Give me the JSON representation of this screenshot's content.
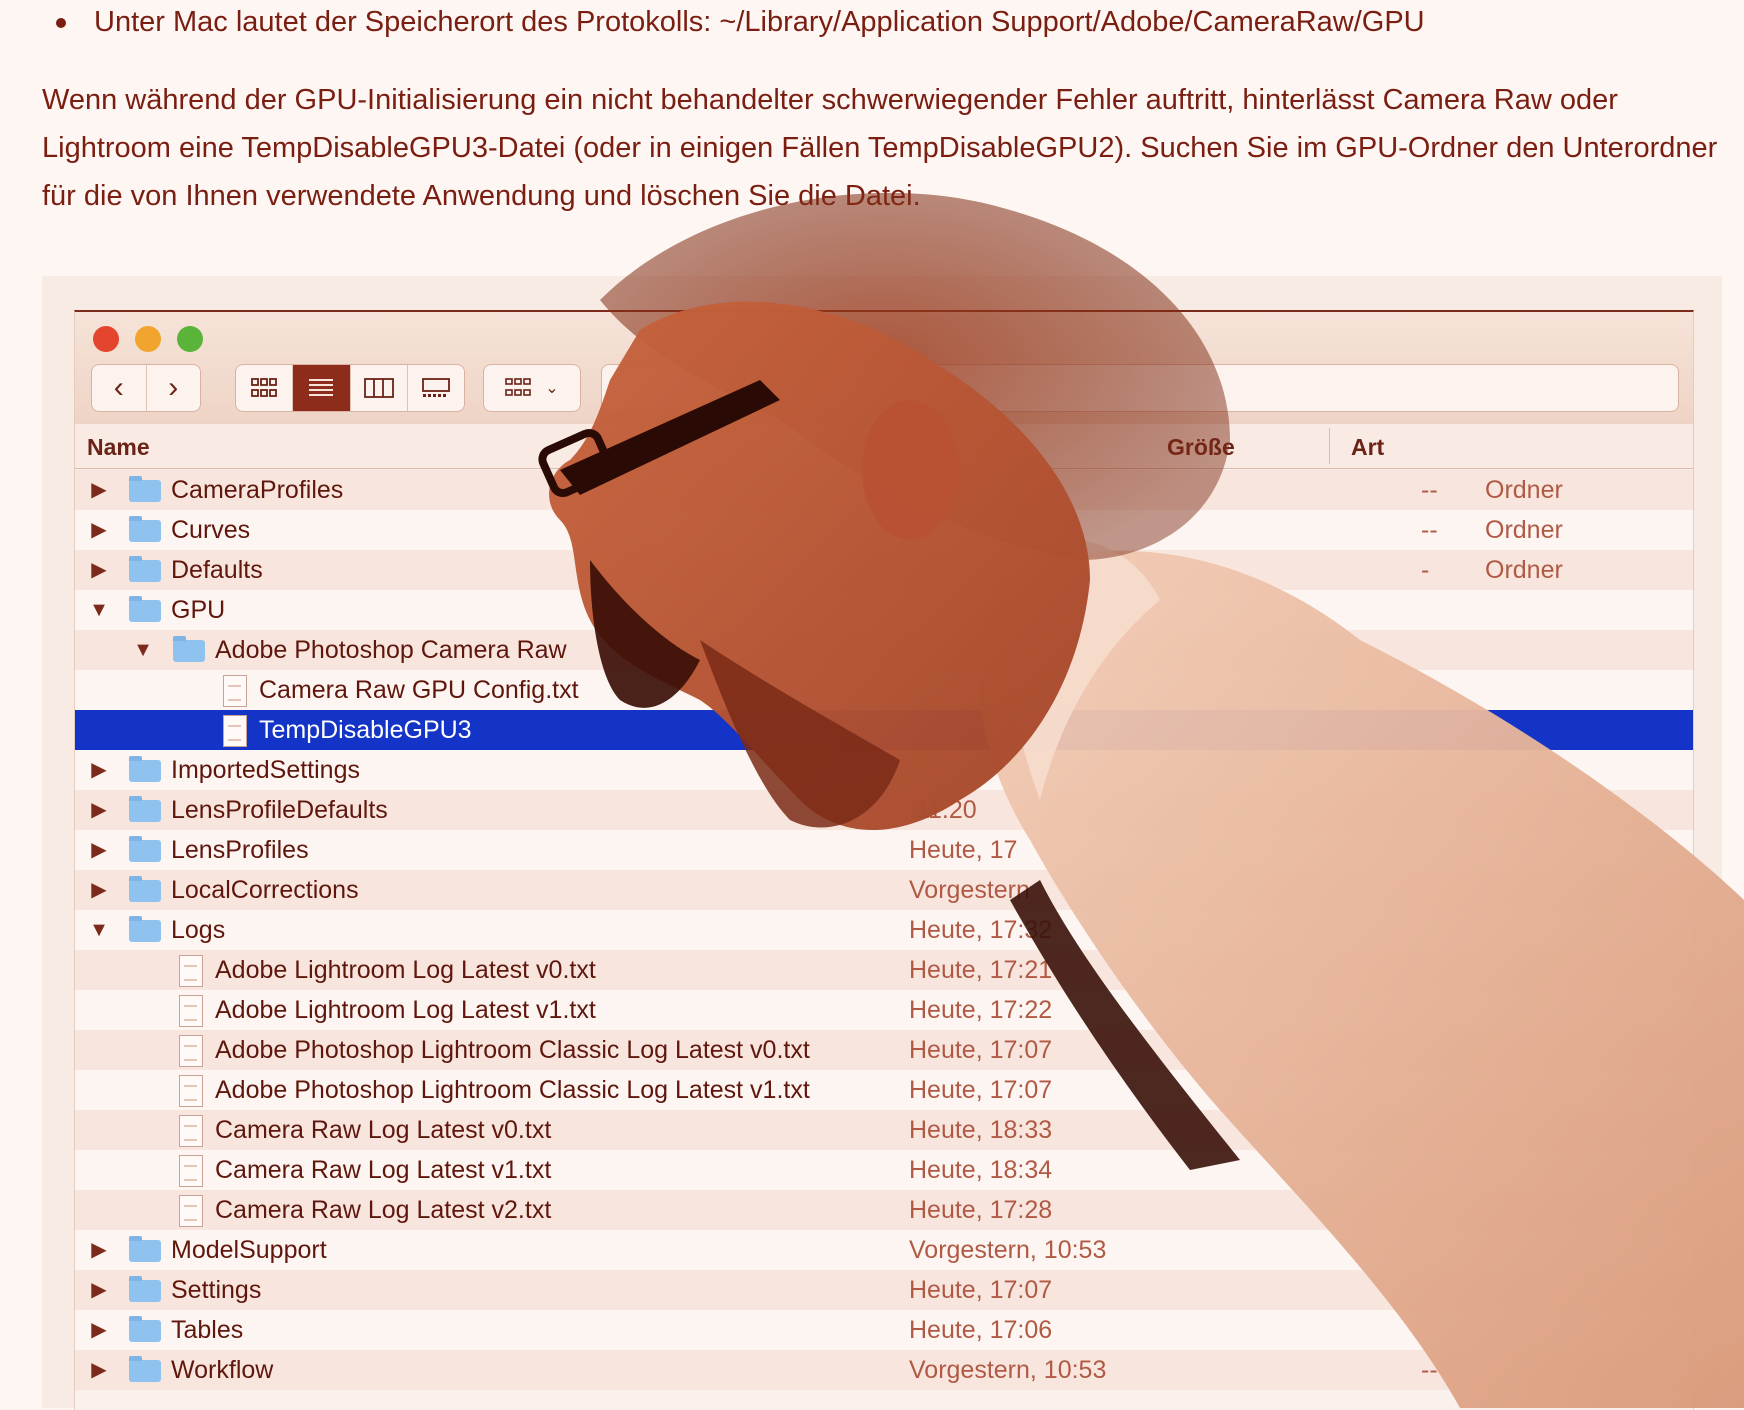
{
  "intro": {
    "bullet": "Unter Mac lautet der Speicherort des Protokolls: ~/Library/Application Support/Adobe/CameraRaw/GPU",
    "paragraph_lines": [
      "Wenn während der GPU-Initialisierung ein nicht behandelter schwerwiegender Fehler auftritt, hinterlässt Camera Raw oder",
      "Lightroom eine TempDisableGPU3-Datei (oder in einigen Fällen TempDisableGPU2). Suchen Sie im GPU-Ordner den Unterordner",
      "für die von Ihnen verwendete Anwendung und löschen Sie die Datei."
    ]
  },
  "toolbar": {
    "back_icon": "chevron-left-icon",
    "forward_icon": "chevron-right-icon",
    "views": [
      "icon-view",
      "list-view",
      "column-view",
      "gallery-view"
    ],
    "active_view": "list-view"
  },
  "columns": {
    "name": "Name",
    "size": "Größe",
    "kind": "Art"
  },
  "rows": [
    {
      "name": "CameraProfiles",
      "type": "folder",
      "level": 0,
      "disclosure": "▶",
      "date": "",
      "size": "--",
      "kind": "Ordner"
    },
    {
      "name": "Curves",
      "type": "folder",
      "level": 0,
      "disclosure": "▶",
      "date": "",
      "size": "--",
      "kind": "Ordner"
    },
    {
      "name": "Defaults",
      "type": "folder",
      "level": 0,
      "disclosure": "▶",
      "date": "",
      "size": "-",
      "kind": "Ordner"
    },
    {
      "name": "GPU",
      "type": "folder",
      "level": 0,
      "disclosure": "▼",
      "date": "",
      "size": "",
      "kind": ""
    },
    {
      "name": "Adobe Photoshop Camera Raw",
      "type": "folder",
      "level": 1,
      "disclosure": "▼",
      "date": "",
      "size": "",
      "kind": ""
    },
    {
      "name": "Camera Raw GPU Config.txt",
      "type": "doc",
      "level": 2,
      "disclosure": "",
      "date": "",
      "size": "",
      "kind": ""
    },
    {
      "name": "TempDisableGPU3",
      "type": "doc",
      "level": 2,
      "disclosure": "",
      "date": "",
      "size": "",
      "kind": "",
      "selected": true
    },
    {
      "name": "ImportedSettings",
      "type": "folder",
      "level": 0,
      "disclosure": "▶",
      "date": "",
      "size": "",
      "kind": ""
    },
    {
      "name": "LensProfileDefaults",
      "type": "folder",
      "level": 0,
      "disclosure": "▶",
      "date": ".11.20",
      "size": "",
      "kind": ""
    },
    {
      "name": "LensProfiles",
      "type": "folder",
      "level": 0,
      "disclosure": "▶",
      "date": "Heute, 17",
      "size": "",
      "kind": ""
    },
    {
      "name": "LocalCorrections",
      "type": "folder",
      "level": 0,
      "disclosure": "▶",
      "date": "Vorgestern",
      "size": "",
      "kind": ""
    },
    {
      "name": "Logs",
      "type": "folder",
      "level": 0,
      "disclosure": "▼",
      "date": "Heute, 17:32",
      "size": "",
      "kind": ""
    },
    {
      "name": "Adobe Lightroom Log Latest v0.txt",
      "type": "doc",
      "level": 1,
      "disclosure": "",
      "date": "Heute, 17:21",
      "size": "",
      "kind": ""
    },
    {
      "name": "Adobe Lightroom Log Latest v1.txt",
      "type": "doc",
      "level": 1,
      "disclosure": "",
      "date": "Heute, 17:22",
      "size": "",
      "kind": ""
    },
    {
      "name": "Adobe Photoshop Lightroom Classic Log Latest v0.txt",
      "type": "doc",
      "level": 1,
      "disclosure": "",
      "date": "Heute, 17:07",
      "size": "",
      "kind": ""
    },
    {
      "name": "Adobe Photoshop Lightroom Classic Log Latest v1.txt",
      "type": "doc",
      "level": 1,
      "disclosure": "",
      "date": "Heute, 17:07",
      "size": "",
      "kind": ""
    },
    {
      "name": "Camera Raw Log Latest v0.txt",
      "type": "doc",
      "level": 1,
      "disclosure": "",
      "date": "Heute, 18:33",
      "size": "",
      "kind": ""
    },
    {
      "name": "Camera Raw Log Latest v1.txt",
      "type": "doc",
      "level": 1,
      "disclosure": "",
      "date": "Heute, 18:34",
      "size": "",
      "kind": ""
    },
    {
      "name": "Camera Raw Log Latest v2.txt",
      "type": "doc",
      "level": 1,
      "disclosure": "",
      "date": "Heute, 17:28",
      "size": "",
      "kind": ""
    },
    {
      "name": "ModelSupport",
      "type": "folder",
      "level": 0,
      "disclosure": "▶",
      "date": "Vorgestern, 10:53",
      "size": "",
      "kind": ""
    },
    {
      "name": "Settings",
      "type": "folder",
      "level": 0,
      "disclosure": "▶",
      "date": "Heute, 17:07",
      "size": "",
      "kind": ""
    },
    {
      "name": "Tables",
      "type": "folder",
      "level": 0,
      "disclosure": "▶",
      "date": "Heute, 17:06",
      "size": "",
      "kind": ""
    },
    {
      "name": "Workflow",
      "type": "folder",
      "level": 0,
      "disclosure": "▶",
      "date": "Vorgestern, 10:53",
      "size": "--",
      "kind": ""
    }
  ],
  "colors": {
    "text": "#7a1e12",
    "selection": "#1433c7",
    "window_bg": "#fbf1ec",
    "overlay_tint": "#a83a1e"
  },
  "overlay": {
    "icon": "screaming-man-photo"
  }
}
